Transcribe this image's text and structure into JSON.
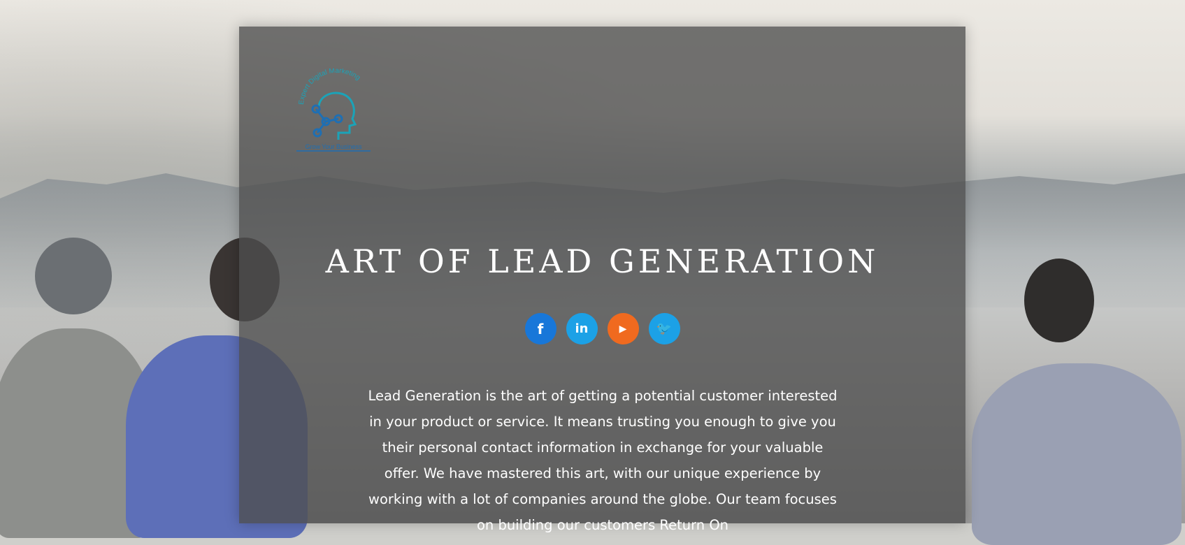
{
  "logo": {
    "arc_text": "Expert Digital Marketing",
    "base_text": "Grow Your Business"
  },
  "hero": {
    "title": "ART OF LEAD GENERATION",
    "description": "Lead Generation is the art of getting a potential customer interested in your product or service. It means trusting you enough to give you their personal contact information in exchange for your valuable offer. We have mastered this art, with our unique experience by working with a lot of companies around the globe. Our team focuses on building our customers Return On"
  },
  "socials": [
    {
      "icon": "facebook-icon",
      "glyph": "f",
      "color": "#1877d9"
    },
    {
      "icon": "linkedin-icon",
      "glyph": "in",
      "color": "#1ca1e6"
    },
    {
      "icon": "youtube-icon",
      "glyph": "▶",
      "color": "#f06a1f"
    },
    {
      "icon": "twitter-icon",
      "glyph": "🐦",
      "color": "#1ca1e6"
    }
  ],
  "colors": {
    "overlay": "#4e4e4e",
    "logo_teal": "#1ba3b8",
    "logo_blue": "#1f6fb3"
  }
}
